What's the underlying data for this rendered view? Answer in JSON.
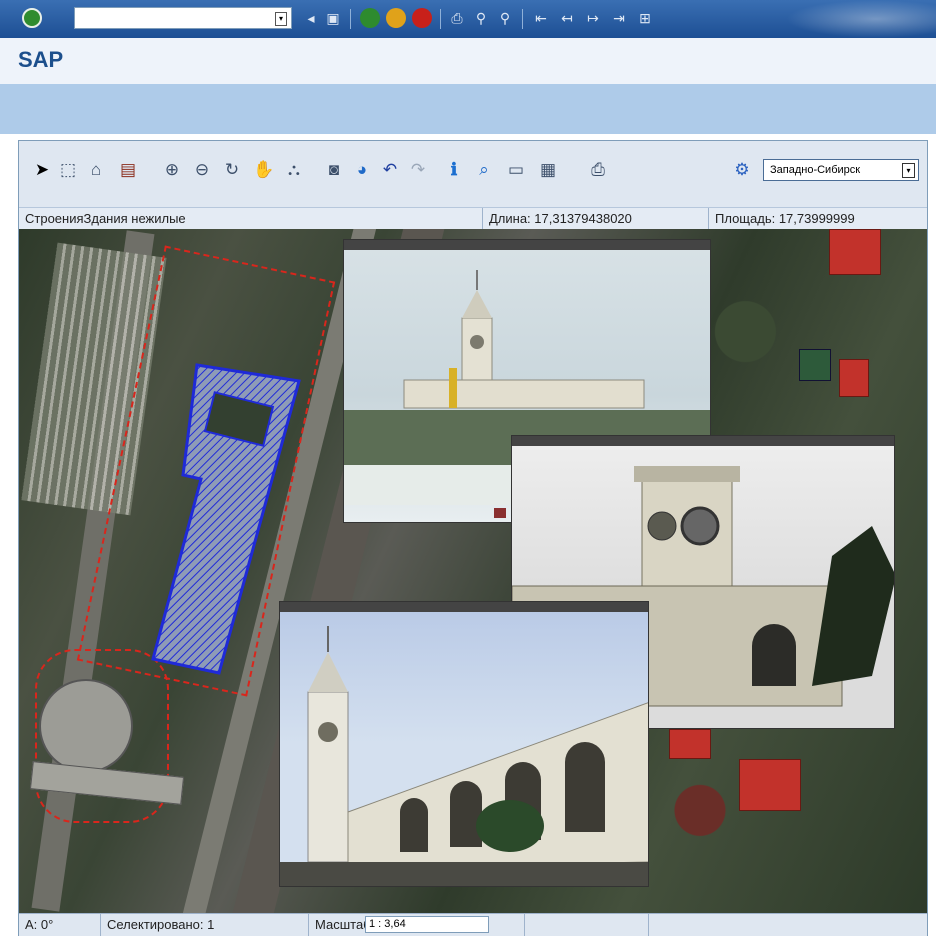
{
  "app": {
    "title": "SAP"
  },
  "toolbar": {
    "command_field_value": ""
  },
  "gis": {
    "region_select": "Западно-Сибирск"
  },
  "infobar": {
    "layer": "СтроенияЗдания нежилые",
    "length": "Длина: 17,31379438020",
    "area": "Площадь: 17,73999999"
  },
  "status": {
    "angle": "А: 0°",
    "selected": "Селектировано: 1",
    "scale_label": "Масштаб",
    "scale_value": "1 : 3,64"
  },
  "colors": {
    "sap_blue": "#1d4f94",
    "title_blue": "#1c4f8c",
    "selection_blue": "#1f2ad8",
    "parcel_red": "#d9261c"
  }
}
